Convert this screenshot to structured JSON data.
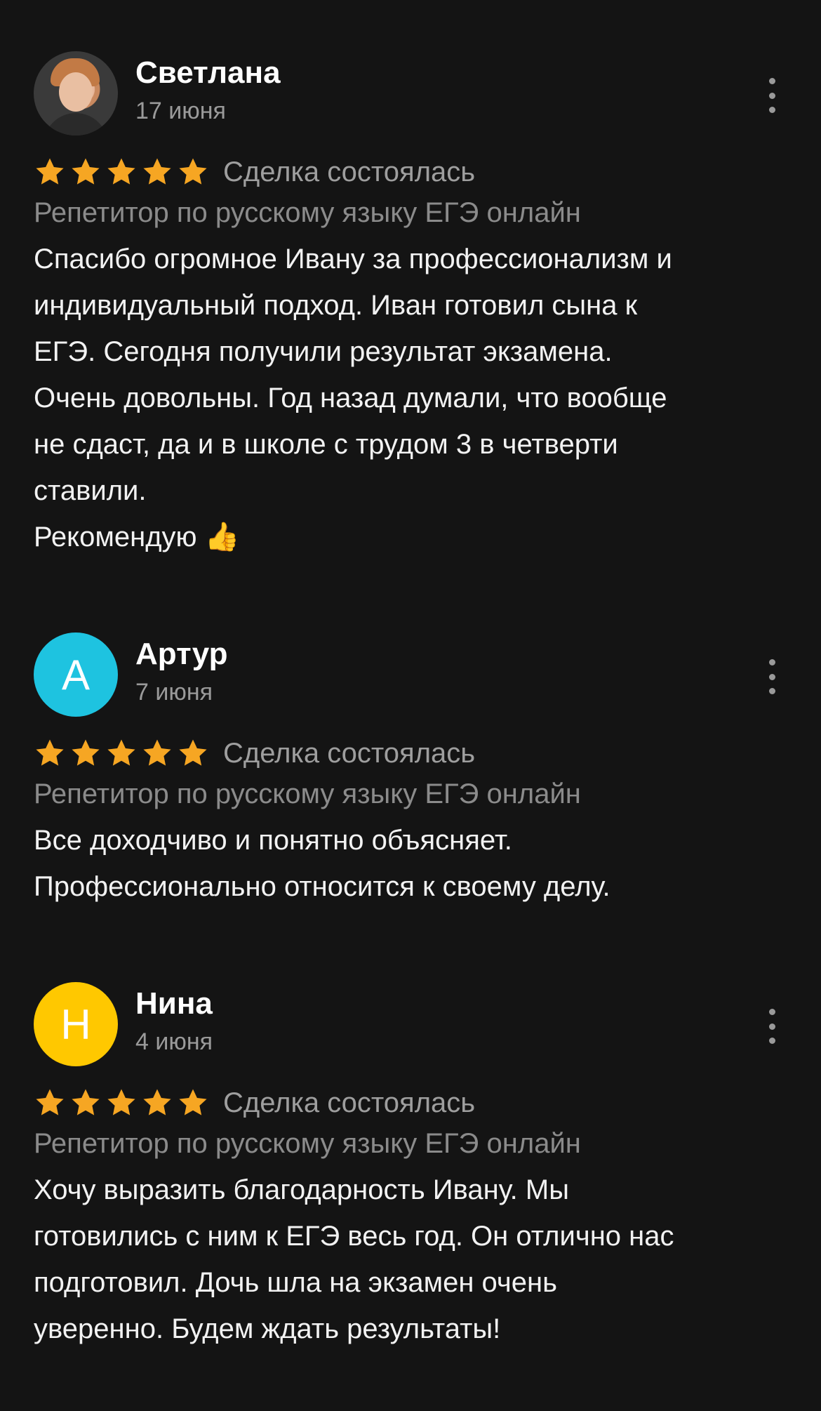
{
  "colors": {
    "background": "#141414",
    "star": "#f6a623",
    "avatar_artur": "#1ec3e0",
    "avatar_nina": "#ffc800",
    "muted_text": "#9a9a9a"
  },
  "reviews": [
    {
      "name": "Светлана",
      "date": "17 июня",
      "avatar_type": "photo",
      "rating": 5,
      "deal_status": "Сделка состоялась",
      "service": "Репетитор по русскому языку ЕГЭ онлайн",
      "text_lines": [
        "Спасибо огромное Ивану за профессионализм  и",
        "индивидуальный подход. Иван готовил сына к",
        "ЕГЭ.  Сегодня получили результат экзамена.",
        "Очень довольны. Год назад думали, что вообще",
        "не сдаст, да и  в школе с трудом 3 в четверти",
        "ставили.",
        "Рекомендую 👍"
      ]
    },
    {
      "name": "Артур",
      "date": "7 июня",
      "avatar_letter": "А",
      "rating": 5,
      "deal_status": "Сделка состоялась",
      "service": "Репетитор по русскому языку ЕГЭ онлайн",
      "text_lines": [
        "Все доходчиво и понятно объясняет.",
        "Профессионально относится к своему делу."
      ]
    },
    {
      "name": "Нина",
      "date": "4 июня",
      "avatar_letter": "Н",
      "rating": 5,
      "deal_status": "Сделка состоялась",
      "service": "Репетитор по русскому языку ЕГЭ онлайн",
      "text_lines": [
        "Хочу выразить благодарность Ивану. Мы",
        "готовились с ним к ЕГЭ весь год. Он отлично нас",
        "подготовил. Дочь шла на экзамен очень",
        "уверенно. Будем ждать результаты!"
      ]
    }
  ]
}
